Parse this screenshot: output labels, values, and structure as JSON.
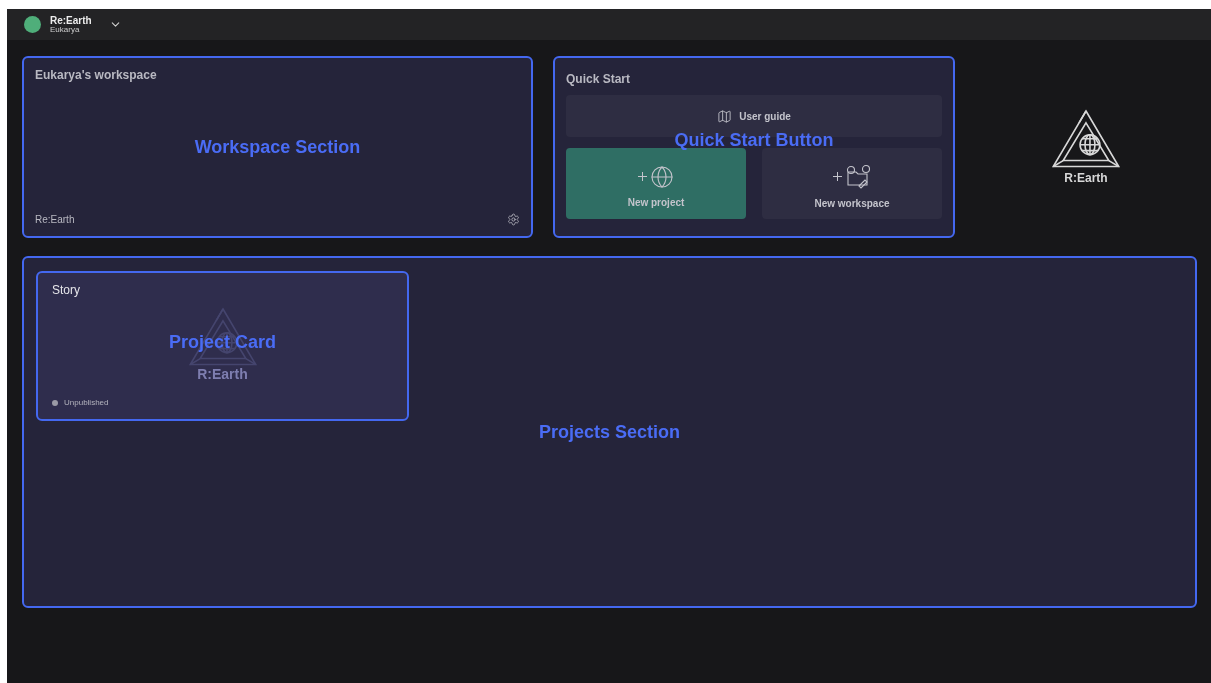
{
  "header": {
    "team_name": "Re:Earth",
    "user_name": "Eukarya"
  },
  "workspace": {
    "title": "Eukarya's workspace",
    "footer": "Re:Earth",
    "annotation": "Workspace Section"
  },
  "quick_start": {
    "title": "Quick Start",
    "annotation": "Quick Start Button",
    "buttons": [
      {
        "kind": "wide",
        "label": "User guide"
      },
      {
        "kind": "primary",
        "label": "New project"
      },
      {
        "kind": "secondary",
        "label": "New workspace"
      }
    ]
  },
  "brand_logo": {
    "text": "R:Earth"
  },
  "projects": {
    "annotation": "Projects Section",
    "cards": [
      {
        "title": "Story",
        "status": "Unpublished",
        "published": false,
        "logo_text": "R:Earth",
        "annotation": "Project Card"
      }
    ]
  }
}
